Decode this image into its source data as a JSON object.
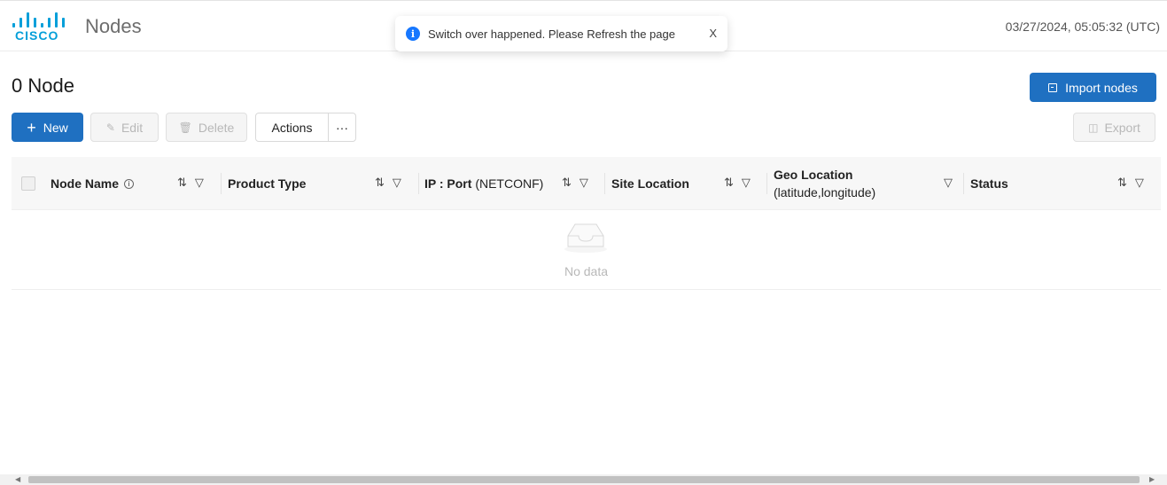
{
  "header": {
    "logo_text": "CISCO",
    "title": "Nodes",
    "datetime": "03/27/2024, 05:05:32 (UTC)"
  },
  "toast": {
    "icon": "info-icon",
    "message": "Switch over happened. Please Refresh the page",
    "close_label": "X"
  },
  "page": {
    "count_title": "0 Node",
    "import_label": "Import nodes"
  },
  "toolbar": {
    "new_label": "New",
    "edit_label": "Edit",
    "delete_label": "Delete",
    "actions_label": "Actions",
    "more_label": "···",
    "export_label": "Export"
  },
  "table": {
    "columns": [
      {
        "label": "Node Name",
        "sortable": true,
        "filterable": true,
        "has_info": true
      },
      {
        "label": "Product Type",
        "sortable": true,
        "filterable": true
      },
      {
        "label": "IP : Port",
        "sub": "(NETCONF)",
        "sortable": true,
        "filterable": true
      },
      {
        "label": "Site Location",
        "sortable": true,
        "filterable": true
      },
      {
        "label": "Geo Location",
        "sub": "(latitude,longitude)",
        "sortable": false,
        "filterable": true
      },
      {
        "label": "Status",
        "sortable": true,
        "filterable": true
      }
    ],
    "rows": [],
    "empty_text": "No data"
  },
  "colors": {
    "brand": "#049fd9",
    "primary": "#1f70c1",
    "info": "#1677ff"
  }
}
